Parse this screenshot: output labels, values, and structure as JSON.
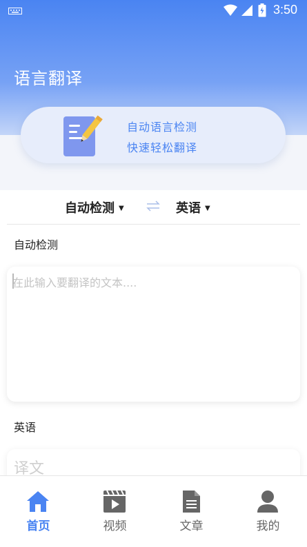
{
  "status": {
    "time": "3:50"
  },
  "header": {
    "title": "语言翻译"
  },
  "banner": {
    "line1": "自动语言检测",
    "line2": "快速轻松翻译"
  },
  "languages": {
    "source": "自动检测",
    "target": "英语"
  },
  "input": {
    "label": "自动检测",
    "placeholder": "在此输入要翻译的文本....",
    "value": ""
  },
  "output": {
    "label": "英语",
    "placeholder": "译文"
  },
  "tabs": [
    {
      "label": "首页",
      "icon": "home-icon",
      "active": true
    },
    {
      "label": "视频",
      "icon": "video-icon",
      "active": false
    },
    {
      "label": "文章",
      "icon": "document-icon",
      "active": false
    },
    {
      "label": "我的",
      "icon": "person-icon",
      "active": false
    }
  ],
  "colors": {
    "accent": "#4a84f2",
    "inactive": "#666666",
    "banner_bg": "#e7edfb"
  }
}
